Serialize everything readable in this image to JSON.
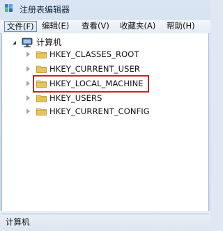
{
  "window": {
    "title": "注册表编辑器",
    "icon": "regedit-icon"
  },
  "menubar": {
    "items": [
      {
        "label": "文件(F)",
        "active": true
      },
      {
        "label": "编辑(E)",
        "active": false
      },
      {
        "label": "查看(V)",
        "active": false
      },
      {
        "label": "收藏夹(A)",
        "active": false
      },
      {
        "label": "帮助(H)",
        "active": false
      }
    ]
  },
  "tree": {
    "root": {
      "label": "计算机",
      "expanded": true,
      "icon": "computer-icon"
    },
    "children": [
      {
        "label": "HKEY_CLASSES_ROOT",
        "expanded": false,
        "icon": "folder-icon"
      },
      {
        "label": "HKEY_CURRENT_USER",
        "expanded": false,
        "icon": "folder-icon"
      },
      {
        "label": "HKEY_LOCAL_MACHINE",
        "expanded": false,
        "icon": "folder-icon",
        "highlighted": true
      },
      {
        "label": "HKEY_USERS",
        "expanded": false,
        "icon": "folder-icon"
      },
      {
        "label": "HKEY_CURRENT_CONFIG",
        "expanded": false,
        "icon": "folder-icon"
      }
    ]
  },
  "statusbar": {
    "text": "计算机"
  },
  "colors": {
    "highlight_border": "#c5252b",
    "folder_yellow": "#e8c45a"
  }
}
